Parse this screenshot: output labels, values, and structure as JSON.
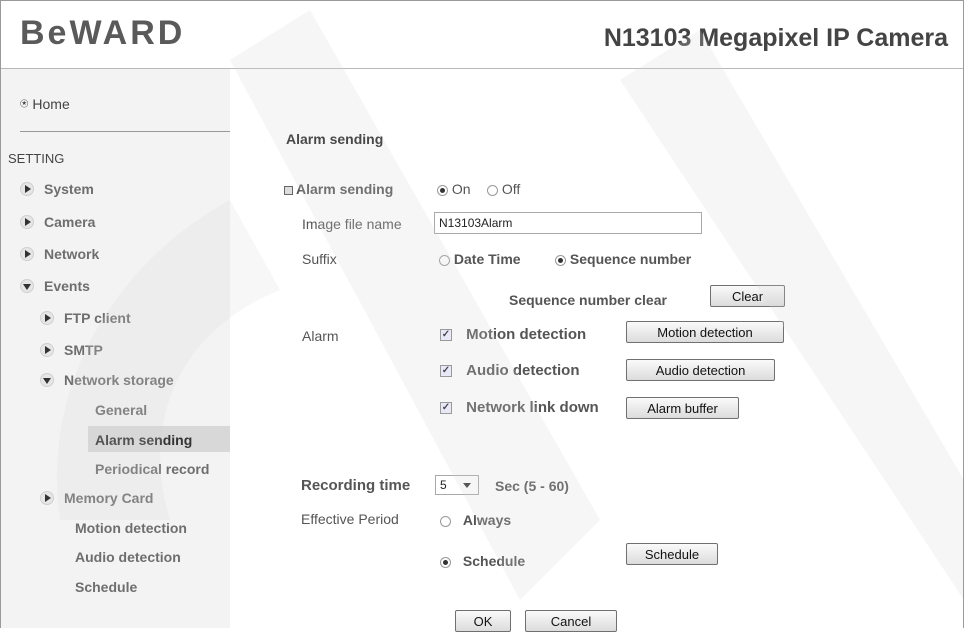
{
  "header": {
    "brand": "BeWARD",
    "product": "N13103 Megapixel IP Camera"
  },
  "sidebar": {
    "home": "Home",
    "setting": "SETTING",
    "items": [
      "System",
      "Camera",
      "Network",
      "Events"
    ],
    "events_children": [
      "FTP client",
      "SMTP",
      "Network storage"
    ],
    "storage_children": [
      "General",
      "Alarm sending",
      "Periodical record"
    ],
    "more": [
      "Memory Card",
      "Motion detection",
      "Audio detection",
      "Schedule"
    ]
  },
  "form": {
    "title": "Alarm sending",
    "alarm_label": "Alarm sending",
    "on": "On",
    "off": "Off",
    "image_file_label": "Image file name",
    "image_file_value": "N13103Alarm",
    "suffix_label": "Suffix",
    "date_time": "Date Time",
    "seq_number": "Sequence number",
    "seq_clear": "Sequence number clear",
    "clear_btn": "Clear",
    "alarm_label2": "Alarm",
    "motion": "Motion detection",
    "motion_btn": "Motion detection",
    "audio": "Audio detection",
    "audio_btn": "Audio detection",
    "netlink": "Network link down",
    "buffer_btn": "Alarm buffer",
    "rec_time_label": "Recording time",
    "rec_time_value": "5",
    "rec_range": "Sec (5 - 60)",
    "period_label": "Effective Period",
    "always": "Always",
    "schedule": "Schedule",
    "schedule_btn": "Schedule",
    "ok": "OK",
    "cancel": "Cancel"
  }
}
